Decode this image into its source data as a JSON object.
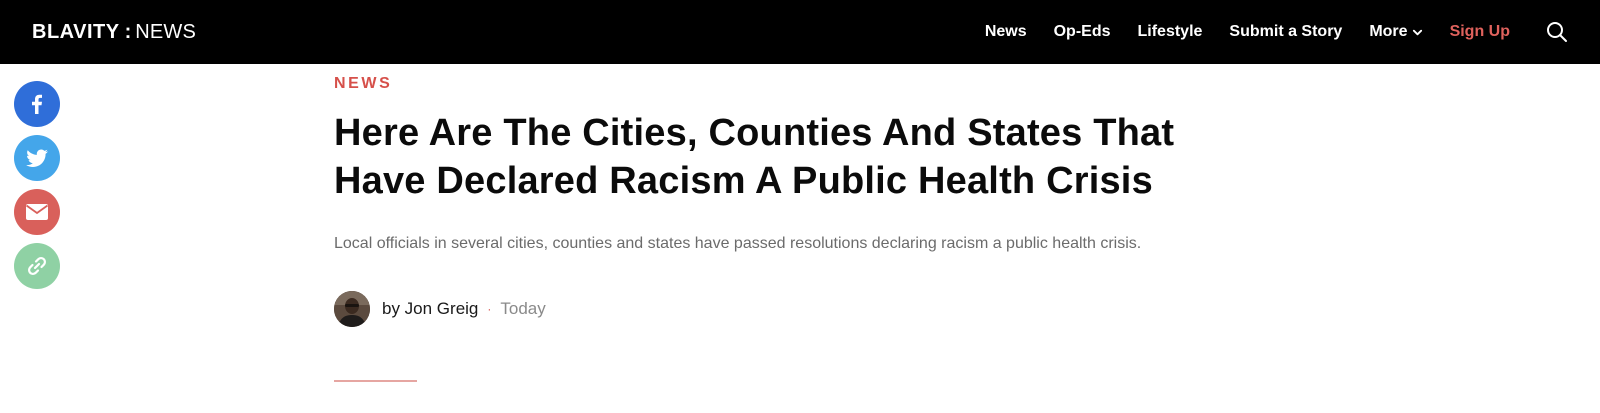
{
  "header": {
    "logo": {
      "brand": "BLAVITY",
      "separator": ":",
      "section": "NEWS"
    },
    "nav": [
      {
        "label": "News"
      },
      {
        "label": "Op-Eds"
      },
      {
        "label": "Lifestyle"
      },
      {
        "label": "Submit a Story"
      },
      {
        "label": "More"
      },
      {
        "label": "Sign Up"
      }
    ],
    "search_icon": "search-icon"
  },
  "share": {
    "items": [
      {
        "icon": "facebook-icon",
        "color": "#2f6ed9"
      },
      {
        "icon": "twitter-icon",
        "color": "#44a6ea"
      },
      {
        "icon": "email-icon",
        "color": "#d9605b"
      },
      {
        "icon": "link-icon",
        "color": "#8fd1a4"
      }
    ]
  },
  "article": {
    "category": "NEWS",
    "title_line1": "Here Are The Cities, Counties And States That",
    "title_line2": "Have Declared Racism A Public Health Crisis",
    "dek": "Local officials in several cities, counties and states have passed resolutions declaring racism a public health crisis.",
    "byline": {
      "author": "by Jon Greig",
      "separator": "·",
      "date": "Today"
    }
  },
  "colors": {
    "accent": "#d6504a",
    "nav_bg": "#000000",
    "signup": "#e0625d"
  }
}
